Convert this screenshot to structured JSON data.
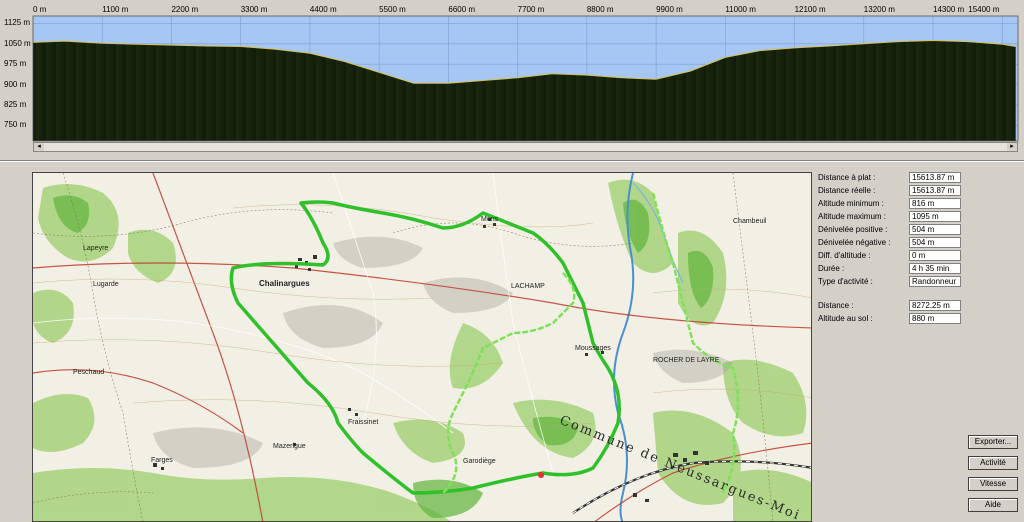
{
  "chart_data": {
    "type": "area",
    "x_ticks": [
      "0 m",
      "1100 m",
      "2200 m",
      "3300 m",
      "4400 m",
      "5500 m",
      "6600 m",
      "7700 m",
      "8800 m",
      "9900 m",
      "11000 m",
      "12100 m",
      "13200 m",
      "14300 m",
      "15400 m"
    ],
    "y_ticks": [
      "1125 m",
      "1050 m",
      "975 m",
      "900 m",
      "825 m",
      "750 m"
    ],
    "xlim": [
      0,
      15650
    ],
    "ylim": [
      693,
      1152
    ],
    "x": [
      0,
      500,
      1100,
      1650,
      2200,
      2750,
      3300,
      3850,
      4400,
      4950,
      5500,
      6050,
      6600,
      7150,
      7700,
      8250,
      8800,
      9350,
      9900,
      10450,
      11000,
      11550,
      12100,
      12650,
      13200,
      13750,
      14300,
      14850,
      15400,
      15613
    ],
    "y": [
      1055,
      1060,
      1052,
      1048,
      1045,
      1042,
      1040,
      1030,
      1015,
      985,
      945,
      905,
      905,
      915,
      925,
      940,
      935,
      925,
      920,
      950,
      1000,
      1025,
      1035,
      1042,
      1050,
      1058,
      1062,
      1058,
      1048,
      1040
    ],
    "colors": {
      "sky": "#a6c6f3",
      "terrain": "#0f1508",
      "stripes": "#4c8a2c"
    }
  },
  "stats": [
    {
      "label": "Distance à plat :",
      "value": "15613.87 m"
    },
    {
      "label": "Distance réelle :",
      "value": "15613.87 m"
    },
    {
      "label": "Altitude minimum :",
      "value": "816 m"
    },
    {
      "label": "Altitude maximum :",
      "value": "1095 m"
    },
    {
      "label": "Dénivelée positive :",
      "value": "504 m"
    },
    {
      "label": "Dénivelée négative :",
      "value": "504 m"
    },
    {
      "label": "Diff. d'altitude :",
      "value": "0 m"
    },
    {
      "label": "Durée :",
      "value": "4 h 35 min"
    },
    {
      "label": "Type d'activité :",
      "value": "Randonneur"
    }
  ],
  "cursor_stats": [
    {
      "label": "Distance :",
      "value": "8272.25 m"
    },
    {
      "label": "Altitude au sol :",
      "value": "880 m"
    }
  ],
  "buttons": {
    "export": "Exporter...",
    "activity": "Activité",
    "speed": "Vitesse",
    "help": "Aide"
  },
  "map": {
    "places": [
      "Chalinargues",
      "Mons",
      "Moussages",
      "Fraissinet",
      "Farges",
      "Mazerigue",
      "Peschaud",
      "LACHAMP",
      "Lugarde",
      "Lapeyre",
      "Chambeuil",
      "Garodiège",
      "ROCHER DE LAYRE"
    ],
    "commune": "Commune de Neussargues-Moi"
  }
}
